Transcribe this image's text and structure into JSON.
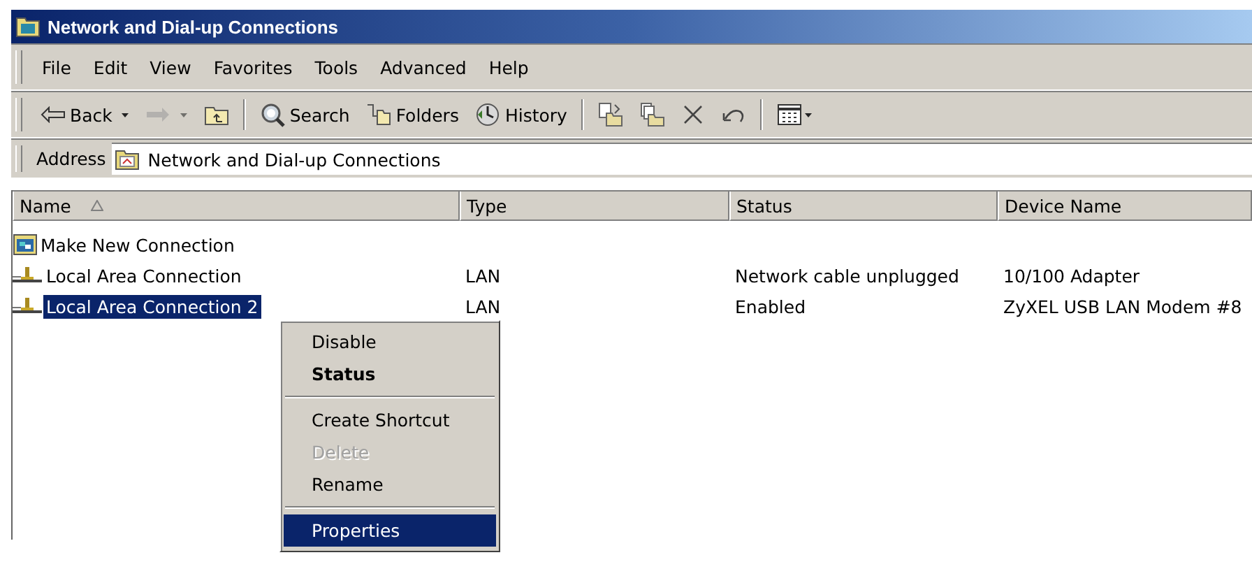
{
  "window": {
    "title": "Network and Dial-up Connections"
  },
  "menu_bar": [
    "File",
    "Edit",
    "View",
    "Favorites",
    "Tools",
    "Advanced",
    "Help"
  ],
  "toolbar": [
    {
      "kind": "back",
      "label": "Back",
      "disabled": false
    },
    {
      "kind": "forward",
      "disabled": true
    },
    {
      "kind": "up",
      "disabled": false
    },
    {
      "kind": "separator"
    },
    {
      "kind": "search",
      "label": "Search",
      "disabled": false
    },
    {
      "kind": "folders",
      "label": "Folders",
      "disabled": false
    },
    {
      "kind": "history",
      "label": "History",
      "disabled": false
    },
    {
      "kind": "separator"
    },
    {
      "kind": "moveto",
      "disabled": false
    },
    {
      "kind": "copyto",
      "disabled": false
    },
    {
      "kind": "delete",
      "disabled": false
    },
    {
      "kind": "undo",
      "disabled": false
    },
    {
      "kind": "separator"
    },
    {
      "kind": "views",
      "disabled": false
    }
  ],
  "address": {
    "label": "Address",
    "value": "Network and Dial-up Connections"
  },
  "table": {
    "columns": [
      {
        "label": "Name",
        "sorted": true
      },
      {
        "label": "Type",
        "sorted": false
      },
      {
        "label": "Status",
        "sorted": false
      },
      {
        "label": "Device Name",
        "sorted": false
      }
    ],
    "rows": [
      {
        "kind": "wizard",
        "selected": false,
        "cells": [
          "Make New Connection",
          "",
          "",
          ""
        ]
      },
      {
        "kind": "lan",
        "selected": false,
        "cells": [
          "Local Area Connection",
          "LAN",
          "Network cable unplugged",
          "10/100 Adapter"
        ]
      },
      {
        "kind": "lan",
        "selected": true,
        "cells": [
          "Local Area Connection 2",
          "LAN",
          "Enabled",
          "ZyXEL USB LAN Modem #8"
        ]
      }
    ]
  },
  "context_menu": [
    {
      "kind": "item",
      "label": "Disable",
      "default": false,
      "disabled": false,
      "selected": false
    },
    {
      "kind": "item",
      "label": "Status",
      "default": true,
      "disabled": false,
      "selected": false
    },
    {
      "kind": "separator"
    },
    {
      "kind": "item",
      "label": "Create Shortcut",
      "default": false,
      "disabled": false,
      "selected": false
    },
    {
      "kind": "item",
      "label": "Delete",
      "default": false,
      "disabled": true,
      "selected": false
    },
    {
      "kind": "item",
      "label": "Rename",
      "default": false,
      "disabled": false,
      "selected": false
    },
    {
      "kind": "separator"
    },
    {
      "kind": "item",
      "label": "Properties",
      "default": false,
      "disabled": false,
      "selected": true
    }
  ]
}
